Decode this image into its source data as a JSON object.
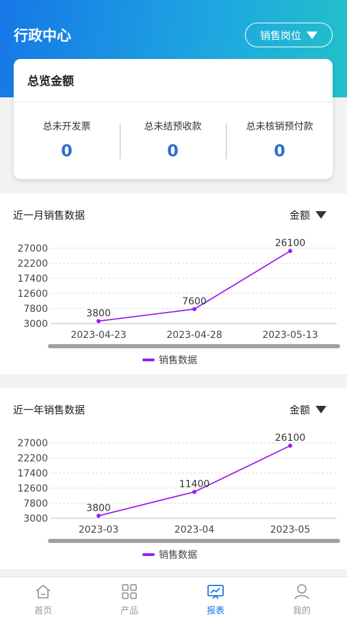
{
  "header": {
    "title": "行政中心",
    "role_selector": {
      "value": "销售岗位",
      "icon": "caret-down-icon"
    }
  },
  "overview": {
    "title": "总览金额",
    "stats": [
      {
        "label": "总未开发票",
        "value": "0"
      },
      {
        "label": "总未结预收款",
        "value": "0"
      },
      {
        "label": "总未核销预付款",
        "value": "0"
      }
    ],
    "value_color": "#2f6fd0"
  },
  "panels": [
    {
      "title": "近一月销售数据",
      "metric": "金额"
    },
    {
      "title": "近一年销售数据",
      "metric": "金额"
    }
  ],
  "chart_data": [
    {
      "type": "line",
      "categories": [
        "2023-04-23",
        "2023-04-28",
        "2023-05-13"
      ],
      "series": [
        {
          "name": "销售数据",
          "values": [
            3800,
            7600,
            26100
          ],
          "color": "#9b1cf0"
        }
      ],
      "y_ticks": [
        3000,
        7800,
        12600,
        17400,
        22200,
        27000
      ],
      "ylim": [
        3000,
        27000
      ],
      "grid": true,
      "legend": "bottom-center"
    },
    {
      "type": "line",
      "categories": [
        "2023-03",
        "2023-04",
        "2023-05"
      ],
      "series": [
        {
          "name": "销售数据",
          "values": [
            3800,
            11400,
            26100
          ],
          "color": "#9b1cf0"
        }
      ],
      "y_ticks": [
        3000,
        7800,
        12600,
        17400,
        22200,
        27000
      ],
      "ylim": [
        3000,
        27000
      ],
      "grid": true,
      "legend": "bottom-center"
    }
  ],
  "tabbar": {
    "items": [
      {
        "label": "首页",
        "icon": "home-icon",
        "active": false
      },
      {
        "label": "产品",
        "icon": "grid-icon",
        "active": false
      },
      {
        "label": "报表",
        "icon": "report-chart-icon",
        "active": true
      },
      {
        "label": "我的",
        "icon": "user-icon",
        "active": false
      }
    ],
    "active_color": "#1677e6",
    "inactive_color": "#999999"
  }
}
